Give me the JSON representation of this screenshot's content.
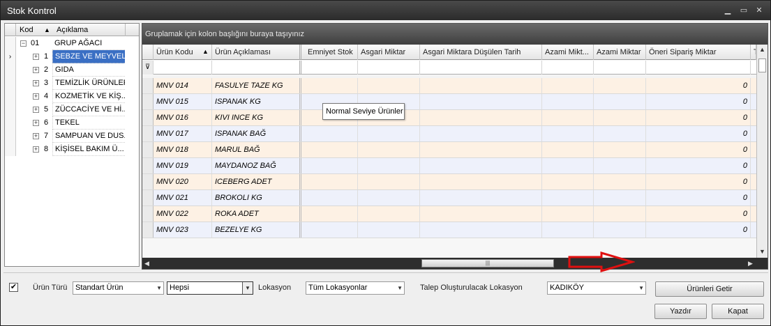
{
  "window": {
    "title": "Stok Kontrol",
    "minimize_glyph": "▁",
    "maximize_glyph": "▭",
    "close_glyph": "✕"
  },
  "tree": {
    "headers": {
      "code": "Kod",
      "sort": "▲",
      "desc": "Açıklama"
    },
    "root": {
      "code": "01",
      "desc": "GRUP AĞACI",
      "toggle": "−"
    },
    "pointer": "›",
    "items": [
      {
        "code": "1",
        "desc": "SEBZE VE MEYVELER"
      },
      {
        "code": "2",
        "desc": "GIDA"
      },
      {
        "code": "3",
        "desc": "TEMİZLİK ÜRÜNLERİ"
      },
      {
        "code": "4",
        "desc": "KOZMETİK VE KİŞ..."
      },
      {
        "code": "5",
        "desc": "ZÜCCACİYE VE Hİ..."
      },
      {
        "code": "6",
        "desc": "TEKEL"
      },
      {
        "code": "7",
        "desc": "SAMPUAN VE DUS..."
      },
      {
        "code": "8",
        "desc": "KİŞİSEL BAKIM Ü..."
      }
    ],
    "expand_glyph": "+"
  },
  "grid": {
    "group_panel": "Gruplamak için kolon başlığını buraya taşıyınız",
    "sort_glyph": "▲",
    "filter_glyph": "⊽",
    "columns": [
      "Ürün Kodu",
      "Ürün Açıklaması",
      "Emniyet Stok",
      "Asgari Miktar",
      "Asgari Miktara Düşülen Tarih",
      "Azami Mikt...",
      "Azami Miktar",
      "Öneri Sipariş Miktar",
      "T"
    ],
    "rows": [
      {
        "code": "MNV 014",
        "desc": "FASULYE TAZE KG",
        "qty": "0"
      },
      {
        "code": "MNV 015",
        "desc": "ISPANAK  KG",
        "qty": "0"
      },
      {
        "code": "MNV 016",
        "desc": "KIVI INCE KG",
        "qty": "0"
      },
      {
        "code": "MNV 017",
        "desc": "ISPANAK BAĞ",
        "qty": "0"
      },
      {
        "code": "MNV 018",
        "desc": "MARUL BAĞ",
        "qty": "0"
      },
      {
        "code": "MNV 019",
        "desc": "MAYDANOZ BAĞ",
        "qty": "0"
      },
      {
        "code": "MNV 020",
        "desc": "ICEBERG ADET",
        "qty": "0"
      },
      {
        "code": "MNV 021",
        "desc": "BROKOLI KG",
        "qty": "0"
      },
      {
        "code": "MNV 022",
        "desc": "ROKA ADET",
        "qty": "0"
      },
      {
        "code": "MNV 023",
        "desc": "BEZELYE  KG",
        "qty": "0"
      }
    ],
    "tooltip": "Normal Seviye Ürünler",
    "scroll_up": "▲",
    "scroll_down": "▼",
    "scroll_left": "◀",
    "scroll_right": "▶",
    "thumb_grip": "|||"
  },
  "filters": {
    "checkbox_mark": "✔",
    "urun_turu_label": "Ürün Türü",
    "urun_turu_value": "Standart Ürün",
    "hepsi_value": "Hepsi",
    "lokasyon_label": "Lokasyon",
    "lokasyon_value": "Tüm Lokasyonlar",
    "talep_label": "Talep Oluşturulacak Lokasyon",
    "talep_value": "KADIKÖY",
    "dropdown_glyph": "▼"
  },
  "buttons": {
    "get_products": "Ürünleri Getir",
    "print": "Yazdır",
    "close": "Kapat"
  },
  "colors": {
    "selected_row": "#3a6fc4",
    "odd_row": "#fdf1e4",
    "even_row": "#eef1fb",
    "annotation_arrow": "#e01010"
  }
}
